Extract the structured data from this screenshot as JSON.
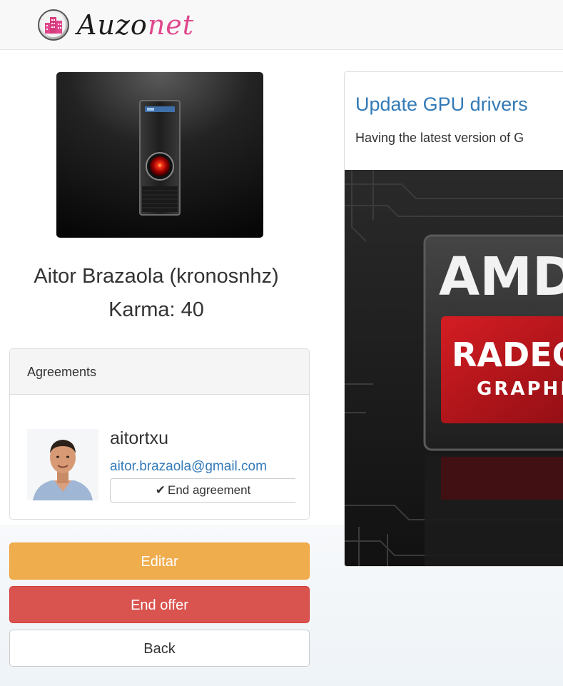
{
  "navbar": {
    "brand_part1": "Auzo",
    "brand_part2": "net",
    "brand_color": "#e0478c"
  },
  "profile": {
    "name": "Aitor Brazaola (kronosnhz)",
    "karma": "Karma: 40"
  },
  "agreements": {
    "heading": "Agreements",
    "items": [
      {
        "username": "aitortxu",
        "email": "aitor.brazaola@gmail.com",
        "end_label": "End agreement",
        "end_icon": "check-icon"
      }
    ]
  },
  "actions": {
    "edit_label": "Editar",
    "end_offer_label": "End offer",
    "back_label": "Back"
  },
  "colors": {
    "edit": "#f0ad4e",
    "end_offer": "#d9534f",
    "link": "#337ab7"
  },
  "offer": {
    "title": "Update GPU drivers",
    "description": "Having the latest version of G",
    "image_text_line1": "AMD",
    "image_text_line2": "RADEON",
    "image_text_line3": "GRAPHICS"
  }
}
